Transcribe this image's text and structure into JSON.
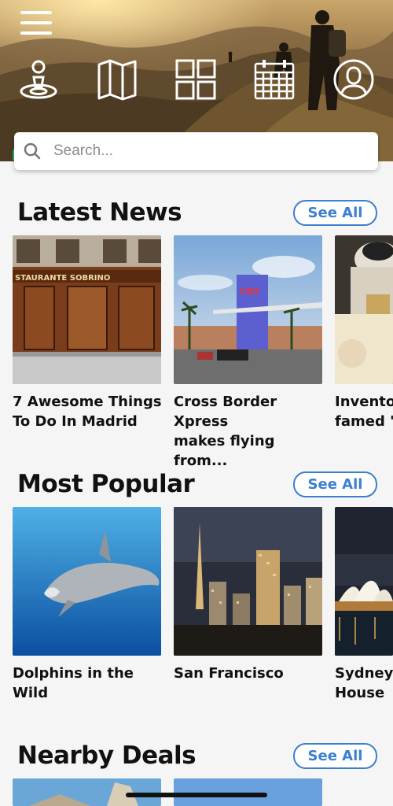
{
  "search": {
    "placeholder": "Search..."
  },
  "sections": [
    {
      "title": "Latest News",
      "see_all": "See All",
      "cards": [
        {
          "line1": "7 Awesome Things",
          "line2": "To Do In Madrid",
          "image": "madrid-restaurant-storefront"
        },
        {
          "line1": "Cross Border Xpress",
          "line2": "makes flying from...",
          "image": "cbx-terminal-building"
        },
        {
          "line1": "Inventor",
          "line2": "famed 'S",
          "image": "bearded-man-signing-book"
        }
      ]
    },
    {
      "title": "Most Popular",
      "see_all": "See All",
      "cards": [
        {
          "line1": "Dolphins in the Wild",
          "line2": "",
          "image": "dolphin-underwater"
        },
        {
          "line1": "San Francisco",
          "line2": "",
          "image": "san-francisco-night-skyline"
        },
        {
          "line1": "Sydney O",
          "line2": "House",
          "image": "sydney-opera-house-night"
        }
      ]
    },
    {
      "title": "Nearby Deals",
      "see_all": "See All",
      "cards": [
        {
          "line1": "",
          "line2": "",
          "image": "coastal-statue"
        },
        {
          "line1": "",
          "line2": "",
          "image": "blue-sky"
        }
      ]
    }
  ],
  "nav_icons": [
    "location-pin-icon",
    "map-icon",
    "grid-icon",
    "calendar-icon",
    "profile-icon"
  ],
  "colors": {
    "accent": "#3d7fcf",
    "background": "#f5f5f5",
    "search_accent": "#2db36b"
  }
}
